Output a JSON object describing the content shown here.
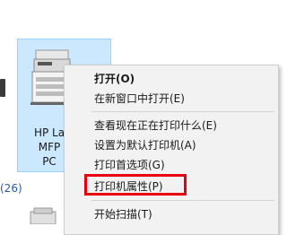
{
  "device": {
    "name_lines": [
      "HP La",
      "MFP",
      "PC"
    ]
  },
  "section": {
    "count_text": "(26)"
  },
  "context_menu": {
    "items": [
      {
        "label": "打开(O)",
        "bold": true
      },
      {
        "label": "在新窗口中打开(E)"
      },
      {
        "label": "查看现在正在打印什么(E)"
      },
      {
        "label": "设置为默认打印机(A)"
      },
      {
        "label": "打印首选项(G)"
      },
      {
        "label": "打印机属性(P)",
        "highlighted": true
      },
      {
        "label": "开始扫描(T)"
      }
    ]
  },
  "colors": {
    "selection_bg": "#cce8ff",
    "highlight_border": "#e60012",
    "menu_bg": "#f2f2f2"
  }
}
